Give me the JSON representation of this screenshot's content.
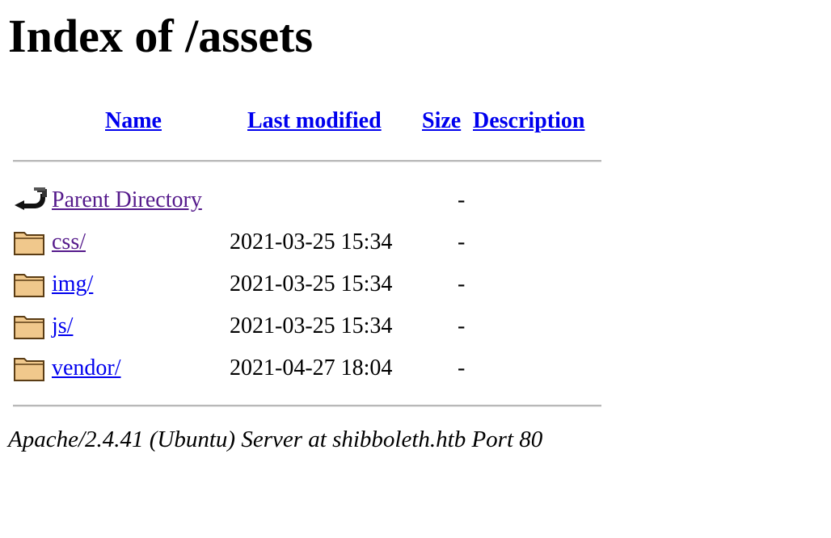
{
  "title": "Index of /assets",
  "headers": {
    "name": "Name",
    "last_modified": "Last modified",
    "size": "Size",
    "description": "Description"
  },
  "rows": [
    {
      "name": "Parent Directory",
      "modified": "",
      "size": "-",
      "description": "",
      "icon": "back-arrow-icon"
    },
    {
      "name": "css/",
      "modified": "2021-03-25 15:34",
      "size": "-",
      "description": "",
      "icon": "folder-icon"
    },
    {
      "name": "img/",
      "modified": "2021-03-25 15:34",
      "size": "-",
      "description": "",
      "icon": "folder-icon"
    },
    {
      "name": "js/",
      "modified": "2021-03-25 15:34",
      "size": "-",
      "description": "",
      "icon": "folder-icon"
    },
    {
      "name": "vendor/",
      "modified": "2021-04-27 18:04",
      "size": "-",
      "description": "",
      "icon": "folder-icon"
    }
  ],
  "footer": "Apache/2.4.41 (Ubuntu) Server at shibboleth.htb Port 80",
  "colors": {
    "link": "#0000ee",
    "visited_link": "#551a8b",
    "rule": "#b8b8b8",
    "folder_fill": "#f0c88c",
    "folder_stroke": "#5a3c14"
  }
}
